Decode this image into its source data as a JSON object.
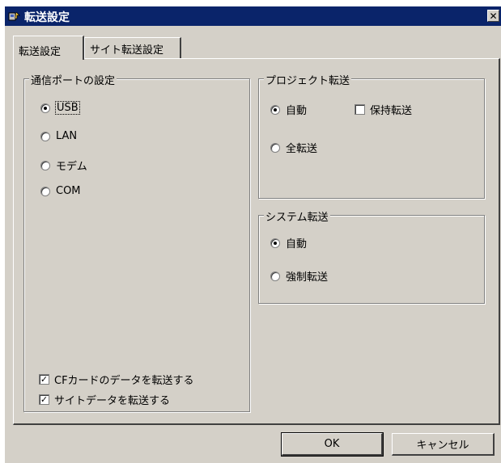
{
  "window": {
    "title": "転送設定",
    "close_glyph": "✕"
  },
  "tabs": [
    {
      "label": "転送設定",
      "active": true
    },
    {
      "label": "サイト転送設定",
      "active": false
    }
  ],
  "port_group": {
    "title": "通信ポートの設定",
    "options": [
      {
        "label": "USB",
        "selected": true
      },
      {
        "label": "LAN",
        "selected": false
      },
      {
        "label": "モデム",
        "selected": false
      },
      {
        "label": "COM",
        "selected": false
      }
    ]
  },
  "checkboxes": [
    {
      "label": "CFカードのデータを転送する",
      "checked": true
    },
    {
      "label": "サイトデータを転送する",
      "checked": true
    }
  ],
  "project_group": {
    "title": "プロジェクト転送",
    "auto_label": "自動",
    "auto_selected": true,
    "all_label": "全転送",
    "all_selected": false,
    "keep_label": "保持転送",
    "keep_checked": false
  },
  "system_group": {
    "title": "システム転送",
    "auto_label": "自動",
    "auto_selected": true,
    "force_label": "強制転送",
    "force_selected": false
  },
  "buttons": {
    "ok": "OK",
    "cancel": "キャンセル"
  },
  "check_glyph": "✓"
}
